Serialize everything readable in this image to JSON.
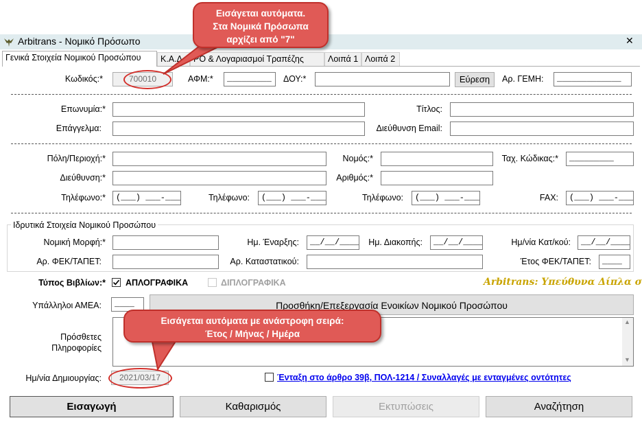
{
  "window": {
    "title": "Arbitrans - Νομικό Πρόσωπο",
    "close_symbol": "✕"
  },
  "tabs": [
    {
      "label": "Γενικά Στοιχεία Νομικού Προσώπου",
      "active": true
    },
    {
      "label": "Κ.Α.Δ."
    },
    {
      "label": "ΡΟ & Λογαριασμοί Τραπέζης"
    },
    {
      "label": "Λοιπά 1"
    },
    {
      "label": "Λοιπά 2"
    }
  ],
  "row1": {
    "code_label": "Κωδικός:*",
    "code_value": "700010",
    "afm_label": "ΑΦΜ:*",
    "afm_value": "_________",
    "doy_label": "ΔΟΥ:*",
    "doy_value": "",
    "search_button": "Εύρεση",
    "gemi_label": "Αρ. ΓΕΜΗ:",
    "gemi_value": "_____________"
  },
  "row2": {
    "name_label": "Επωνυμία:*",
    "name_value": "",
    "title_label": "Τίτλος:",
    "title_value": "",
    "profession_label": "Επάγγελμα:",
    "profession_value": "",
    "email_label": "Διεύθυνση Email:",
    "email_value": ""
  },
  "row3": {
    "city_label": "Πόλη/Περιοχή:*",
    "city_value": "",
    "prefecture_label": "Νομός:*",
    "prefecture_value": "",
    "zip_label": "Ταχ. Κώδικας:*",
    "zip_value": "_________",
    "address_label": "Διεύθυνση:*",
    "address_value": "",
    "number_label": "Αριθμός:*",
    "number_value": "",
    "phone1_label": "Τηλέφωνο:*",
    "phone1_value": "(___) ___-____",
    "phone2_label": "Τηλέφωνο:",
    "phone2_value": "(___) ___-____",
    "phone3_label": "Τηλέφωνο:",
    "phone3_value": "(___) ___-____",
    "fax_label": "FAX:",
    "fax_value": "(___) ___-____"
  },
  "founding": {
    "group_title": "Ιδρυτικά Στοιχεία Νομικού Προσώπου",
    "legal_form_label": "Νομική Μορφή:*",
    "legal_form_value": "",
    "start_date_label": "Ημ. Έναρξης:",
    "start_date_value": "__/__/____",
    "stop_date_label": "Ημ. Διακοπής:",
    "stop_date_value": "__/__/____",
    "filing_date_label": "Ημ/νία Κατ/κού:",
    "filing_date_value": "__/__/____",
    "fek_label": "Αρ. ΦΕΚ/ΤΑΠΕΤ:",
    "fek_value": "",
    "statute_label": "Αρ. Καταστατικού:",
    "statute_value": "",
    "fek_year_label": "Έτος ΦΕΚ/ΤΑΠΕΤ:",
    "fek_year_value": "____"
  },
  "books": {
    "label": "Τύπος Βιβλίων:*",
    "simple_label": "ΑΠΛΟΓΡΑΦΙΚΑ",
    "simple_checked": true,
    "double_label": "ΔΙΠΛΟΓΡΑΦΙΚΑ",
    "double_checked": false,
    "brand_text": "Arbitrans: Υπεύθυνα Δίπλα σας"
  },
  "amea": {
    "label": "Υπάλληλοι ΑΜΕΑ:",
    "value": "____"
  },
  "rental_button": "Προσθήκη/Επεξεργασία Ενοικίων Νομικού Προσώπου",
  "notes": {
    "label_line1": "Πρόσθετες",
    "label_line2": "Πληροφορίες",
    "value": ""
  },
  "created": {
    "label": "Ημ/νία Δημιουργίας:",
    "value": "2021/03/17",
    "article_link": "Ένταξη στο άρθρο 39β, ΠΟΛ-1214 / Συναλλαγές με ενταγμένες οντότητες"
  },
  "actions": {
    "insert": "Εισαγωγή",
    "clear": "Καθαρισμός",
    "print": "Εκτυπώσεις",
    "search": "Αναζήτηση"
  },
  "callouts": {
    "top_line1": "Εισάγεται αυτόματα.",
    "top_line2": "Στα Νομικά Πρόσωπα",
    "top_line3": "αρχίζει από \"7\"",
    "bottom_line1": "Εισάγεται αυτόματα με ανάστροφη σειρά:",
    "bottom_line2": "Έτος / Μήνας / Ημέρα"
  },
  "colors": {
    "titlebar": "#e0ecef",
    "callout": "#e05a56",
    "brand": "#c9a400",
    "link": "#0000ee"
  }
}
